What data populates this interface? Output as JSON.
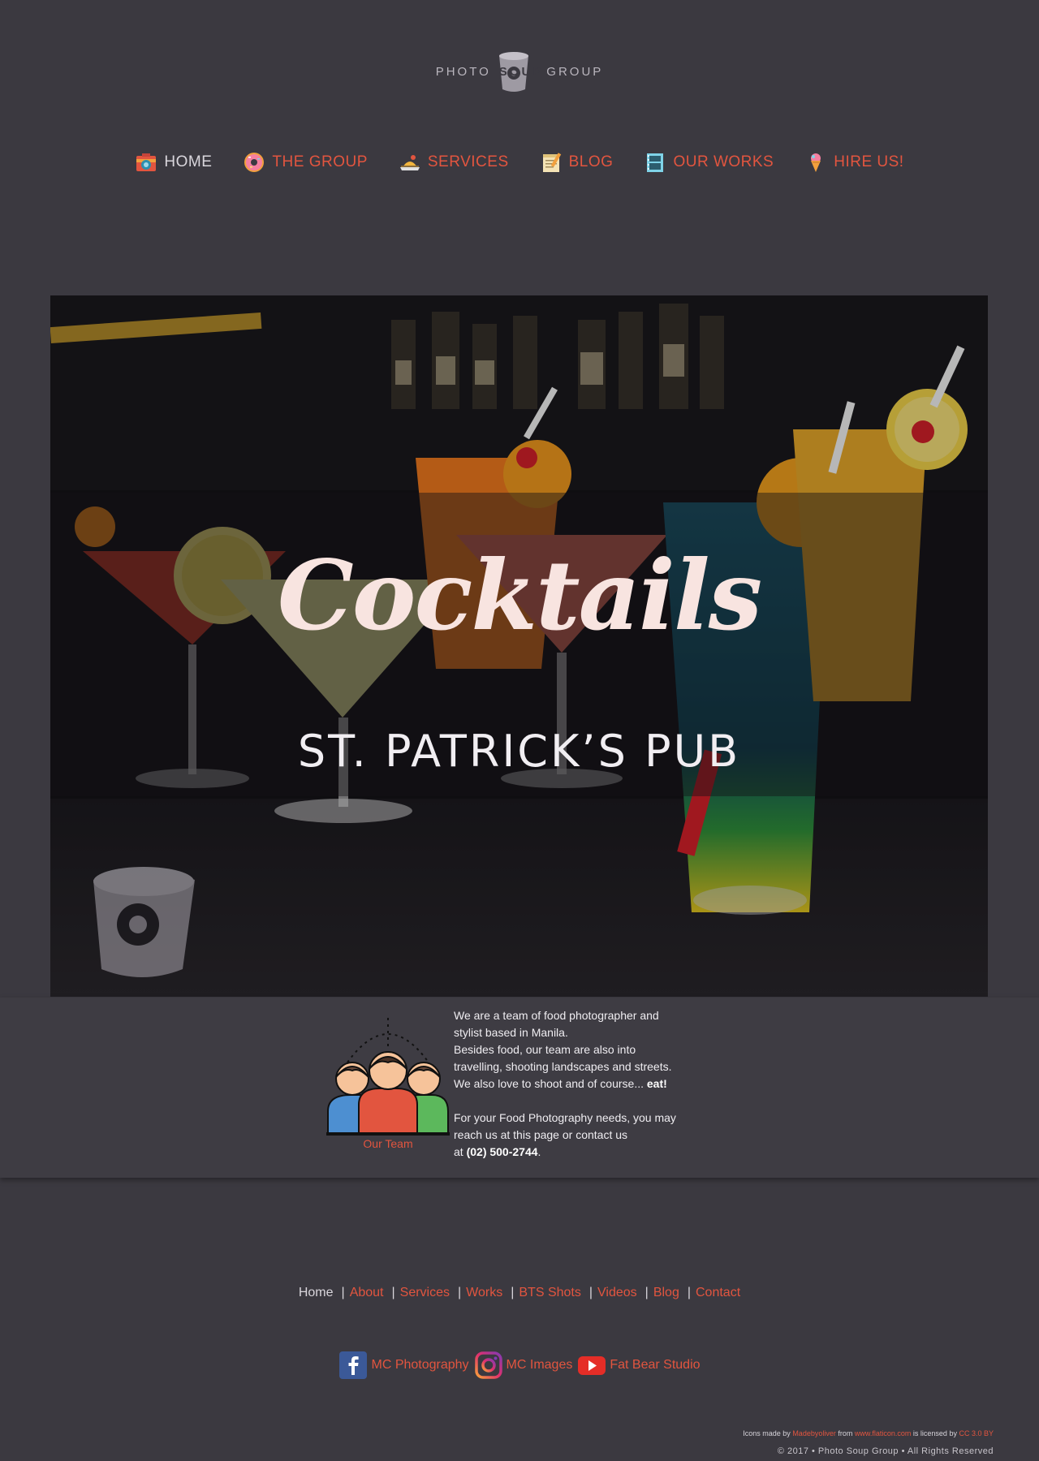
{
  "logo": {
    "left_text": "PHOTO",
    "middle_text": "SOUP",
    "right_text": "GROUP"
  },
  "nav": {
    "items": [
      {
        "label": "HOME",
        "icon": "camera-icon"
      },
      {
        "label": "THE GROUP",
        "icon": "donut-icon"
      },
      {
        "label": "SERVICES",
        "icon": "food-tray-icon"
      },
      {
        "label": "BLOG",
        "icon": "notepad-icon"
      },
      {
        "label": "OUR WORKS",
        "icon": "film-icon"
      },
      {
        "label": "HIRE US!",
        "icon": "ice-cream-icon"
      }
    ]
  },
  "hero": {
    "title": "Cocktails",
    "subtitle": "ST. PATRICK’S PUB"
  },
  "about": {
    "caption": "Our Team",
    "lines": [
      "We are a team of food photographer and",
      "stylist based in Manila.",
      "Besides food, our team are also into",
      "travelling, shooting landscapes and streets.",
      "We also love to shoot and of course...",
      "eat!",
      "For your Food Photography needs, you may",
      "reach us at this page or contact us",
      "at",
      "(02) 500-2744",
      "."
    ]
  },
  "footer": {
    "links": [
      "Home",
      "About",
      "Services",
      "Works",
      "BTS Shots",
      "Videos",
      "Blog",
      "Contact"
    ],
    "separator": "|"
  },
  "social": [
    {
      "label": "MC Photography",
      "icon": "facebook-icon"
    },
    {
      "label": "MC Images",
      "icon": "instagram-icon"
    },
    {
      "label": "Fat Bear Studio",
      "icon": "youtube-icon"
    }
  ],
  "credits": {
    "prefix": "Icons made by",
    "author": "Madebyoliver",
    "from": "from",
    "site": "www.flaticon.com",
    "licensed": "is licensed by",
    "license": "CC 3.0 BY",
    "copyright": "© 2017 • Photo Soup Group • All Rights Reserved"
  },
  "colors": {
    "accent": "#e2553f",
    "background": "#3b3940",
    "nav_active": "#d9d6dc"
  }
}
